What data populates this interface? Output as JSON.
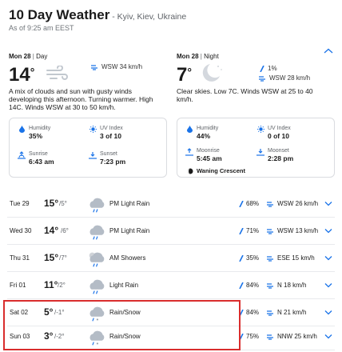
{
  "header": {
    "title": "10 Day Weather",
    "location": " - Kyiv, Kiev, Ukraine",
    "as_of": "As of 9:25 am EEST"
  },
  "day": {
    "date": "Mon 28",
    "period": "Day",
    "temp": "14",
    "wind": "WSW 34 km/h",
    "description": "A mix of clouds and sun with gusty winds developing this afternoon. Turning warmer. High 14C. Winds WSW at 30 to 50 km/h.",
    "humidity_label": "Humidity",
    "humidity": "35%",
    "uv_label": "UV Index",
    "uv": "3 of 10",
    "sunrise_label": "Sunrise",
    "sunrise": "6:43 am",
    "sunset_label": "Sunset",
    "sunset": "7:23 pm"
  },
  "night": {
    "date": "Mon 28",
    "period": "Night",
    "temp": "7",
    "precip": "1%",
    "wind": "WSW 28 km/h",
    "description": "Clear skies. Low 7C. Winds WSW at 25 to 40 km/h.",
    "humidity_label": "Humidity",
    "humidity": "44%",
    "uv_label": "UV Index",
    "uv": "0 of 10",
    "moonrise_label": "Moonrise",
    "moonrise": "5:45 am",
    "moonset_label": "Moonset",
    "moonset": "2:28 pm",
    "moon_phase": "Waning Crescent"
  },
  "forecast": [
    {
      "date": "Tue 29",
      "hi": "15°",
      "lo": "/5°",
      "condition": "PM Light Rain",
      "precip": "68%",
      "wind": "WSW 26 km/h",
      "icon": "cloud-rain-icon"
    },
    {
      "date": "Wed 30",
      "hi": "14°",
      "lo": "/6°",
      "condition": "PM Light Rain",
      "precip": "71%",
      "wind": "WSW 13 km/h",
      "icon": "cloud-rain-icon"
    },
    {
      "date": "Thu 31",
      "hi": "15°",
      "lo": "/7°",
      "condition": "AM Showers",
      "precip": "35%",
      "wind": "ESE 15 km/h",
      "icon": "cloud-sun-rain-icon"
    },
    {
      "date": "Fri 01",
      "hi": "11°",
      "lo": "/2°",
      "condition": "Light Rain",
      "precip": "84%",
      "wind": "N 18 km/h",
      "icon": "cloud-rain-icon"
    },
    {
      "date": "Sat 02",
      "hi": "5°",
      "lo": "/-1°",
      "condition": "Rain/Snow",
      "precip": "84%",
      "wind": "N 21 km/h",
      "icon": "cloud-rain-snow-icon"
    },
    {
      "date": "Sun 03",
      "hi": "3°",
      "lo": "/-2°",
      "condition": "Rain/Snow",
      "precip": "75%",
      "wind": "NNW 25 km/h",
      "icon": "cloud-rain-snow-icon"
    }
  ],
  "colors": {
    "accent": "#1a73e8",
    "highlight": "#d92d2d",
    "cloud": "#b4bcc6"
  }
}
